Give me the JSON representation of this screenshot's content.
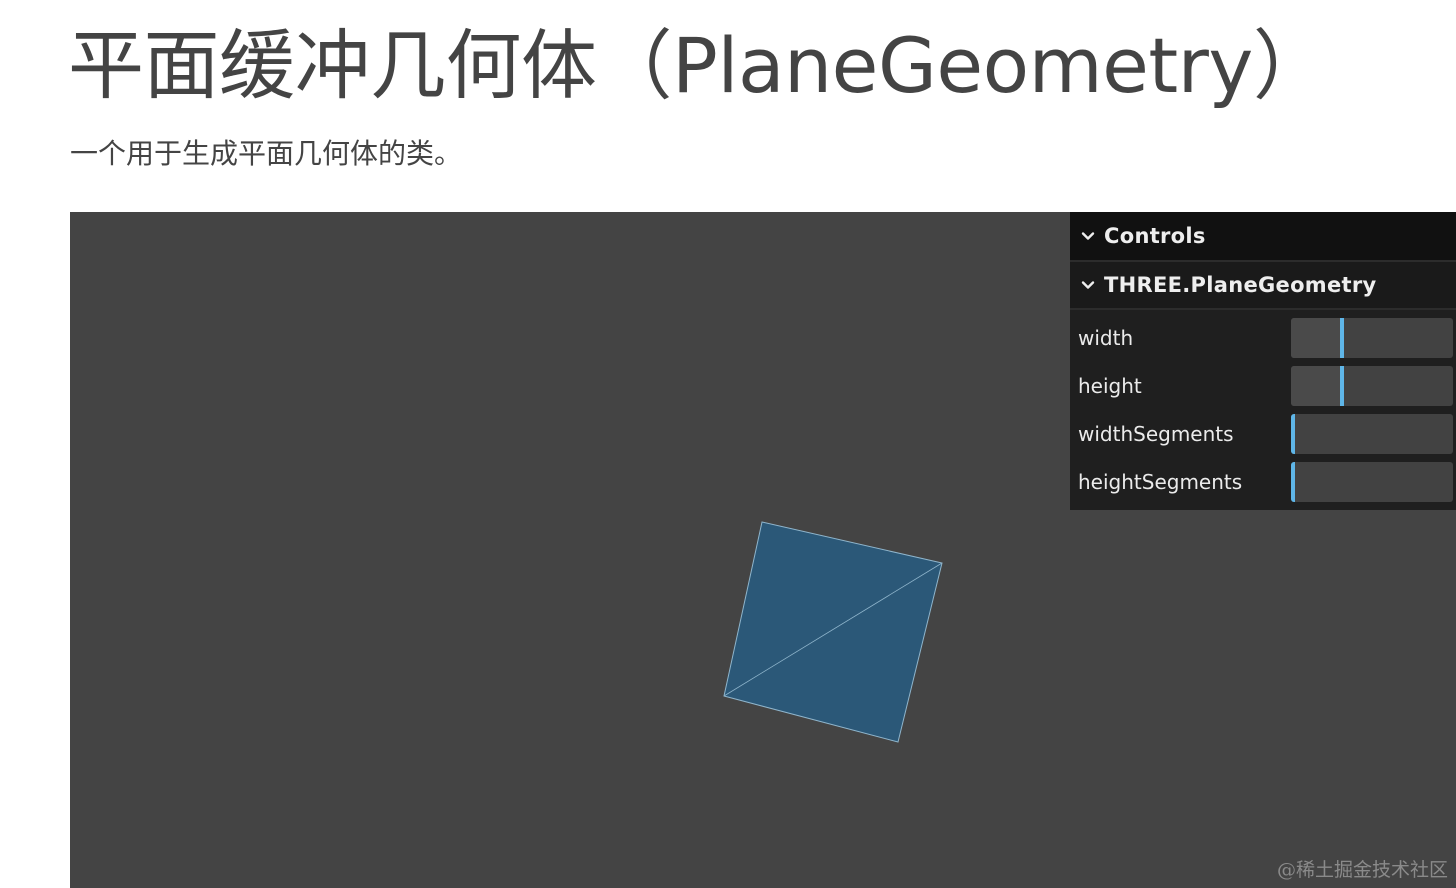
{
  "heading": {
    "title": "平面缓冲几何体（PlaneGeometry）",
    "description": "一个用于生成平面几何体的类。"
  },
  "scene": {
    "background_color": "#444444",
    "plane_fill_color": "#2b5878",
    "plane_edge_color": "#8fb5cc",
    "plane_name": "plane-mesh"
  },
  "gui": {
    "root_title": "Controls",
    "folder_title": "THREE.PlaneGeometry",
    "accent_color": "#5fb6e8",
    "controllers": [
      {
        "label": "width",
        "fraction": 0.31
      },
      {
        "label": "height",
        "fraction": 0.31
      },
      {
        "label": "widthSegments",
        "fraction": 0.0
      },
      {
        "label": "heightSegments",
        "fraction": 0.0
      }
    ]
  },
  "watermark": "@稀土掘金技术社区"
}
